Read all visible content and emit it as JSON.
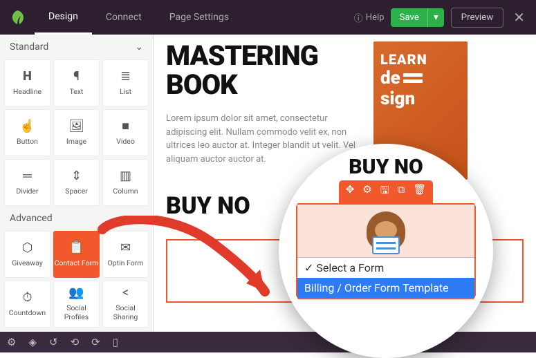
{
  "topnav": {
    "design": "Design",
    "connect": "Connect",
    "page_settings": "Page Settings",
    "help": "Help",
    "save": "Save",
    "preview": "Preview"
  },
  "sidebar": {
    "standard_label": "Standard",
    "advanced_label": "Advanced",
    "standard": [
      {
        "label": "Headline",
        "icon": "H"
      },
      {
        "label": "Text",
        "icon": "¶"
      },
      {
        "label": "List",
        "icon": "≣"
      },
      {
        "label": "Button",
        "icon": "☝"
      },
      {
        "label": "Image",
        "icon": "🖼"
      },
      {
        "label": "Video",
        "icon": "■"
      },
      {
        "label": "Divider",
        "icon": "═"
      },
      {
        "label": "Spacer",
        "icon": "⇕"
      },
      {
        "label": "Column",
        "icon": "▥"
      }
    ],
    "advanced": [
      {
        "label": "Giveaway",
        "icon": "⬡"
      },
      {
        "label": "Contact Form",
        "icon": "📋"
      },
      {
        "label": "Optin Form",
        "icon": "✉"
      },
      {
        "label": "Countdown",
        "icon": "⏱"
      },
      {
        "label": "Social Profiles",
        "icon": "👥"
      },
      {
        "label": "Social Sharing",
        "icon": "<"
      }
    ]
  },
  "hero": {
    "title1": "MASTERING",
    "title2": "BOOK",
    "body": "Lorem ipsum dolor sit amet, consectetur adipiscing elit. Nullam commodo velit ex, non ultrices leo auctor at. Integer blandit ut velit. Vel aliquam auctor auctor at.",
    "img": {
      "learn": "LEARN",
      "de": "de",
      "sign": "sign"
    },
    "buy": "BUY NO"
  },
  "mag": {
    "buy": "BUY NO",
    "select_placeholder": "Select a Form",
    "selected_option": "Billing / Order Form Template"
  }
}
